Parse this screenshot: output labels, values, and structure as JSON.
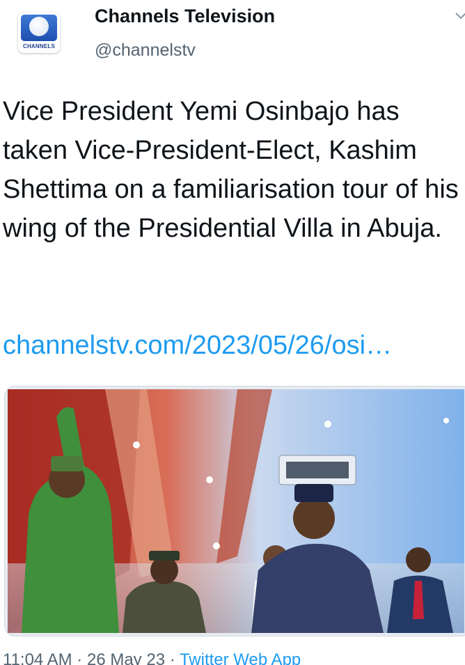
{
  "account": {
    "avatar_icon": "channels-tv-logo-icon",
    "avatar_brand_text": "CHANNELS",
    "display_name": "Channels Television",
    "handle": "@channelstv"
  },
  "tweet": {
    "text": "Vice President Yemi Osinbajo has taken Vice-President-Elect, Kashim Shettima on a familiarisation tour of his wing of the Presidential Villa in Abuja.",
    "link": "channelstv.com/2023/05/26/osi…"
  },
  "media": {
    "type": "photo"
  },
  "meta": {
    "time": "11:04 AM",
    "separator": "·",
    "date": "26 May 23",
    "source": "Twitter Web App"
  },
  "icons": {
    "more": "chevron-down-icon"
  },
  "colors": {
    "link": "#1d9bf0",
    "secondary_text": "#536471",
    "primary_text": "#0f1419"
  }
}
